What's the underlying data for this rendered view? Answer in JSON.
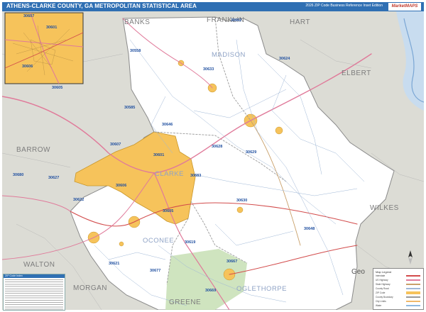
{
  "map": {
    "title": "ATHENS-CLARKE COUNTY, GA METROPOLITAN STATISTICAL AREA",
    "subtitle": "2026 ZIP Code Business Reference Inset Edition",
    "logo": "MarketMAPS",
    "counties_in_msa": [
      "MADISON",
      "CLARKE",
      "OCONEE",
      "OGLETHORPE"
    ],
    "counties_outside": [
      "BANKS",
      "FRANKLIN",
      "HART",
      "ELBERT",
      "BARROW",
      "WALTON",
      "MORGAN",
      "GREENE",
      "WILKES"
    ],
    "cities": [
      "Geo"
    ],
    "zip_codes": [
      "30662",
      "30558",
      "30633",
      "30624",
      "30585",
      "30646",
      "30628",
      "30629",
      "30607",
      "30601",
      "30680",
      "30606",
      "30683",
      "30627",
      "30622",
      "30605",
      "30630",
      "30648",
      "30619",
      "30621",
      "30677",
      "30667",
      "30669"
    ],
    "inset": {
      "zip_codes": [
        "30607",
        "30601",
        "30606",
        "30605"
      ]
    },
    "colors": {
      "zip_highlight": "#f6c35b",
      "msa_land": "#ffffff",
      "outside_land": "#dcdcd5",
      "water": "#8fb9e0",
      "title_bar": "#2f6fb3",
      "zip_label": "#1f4fa0",
      "forest": "#c7dfb4"
    }
  },
  "legend": {
    "title": "Map Legend",
    "rows": [
      "Interstate",
      "US Highway",
      "State Highway",
      "County Road",
      "ZIP Code",
      "County Boundary",
      "City Limits",
      "Water"
    ]
  },
  "index": {
    "title": "ZIP Code Index"
  }
}
